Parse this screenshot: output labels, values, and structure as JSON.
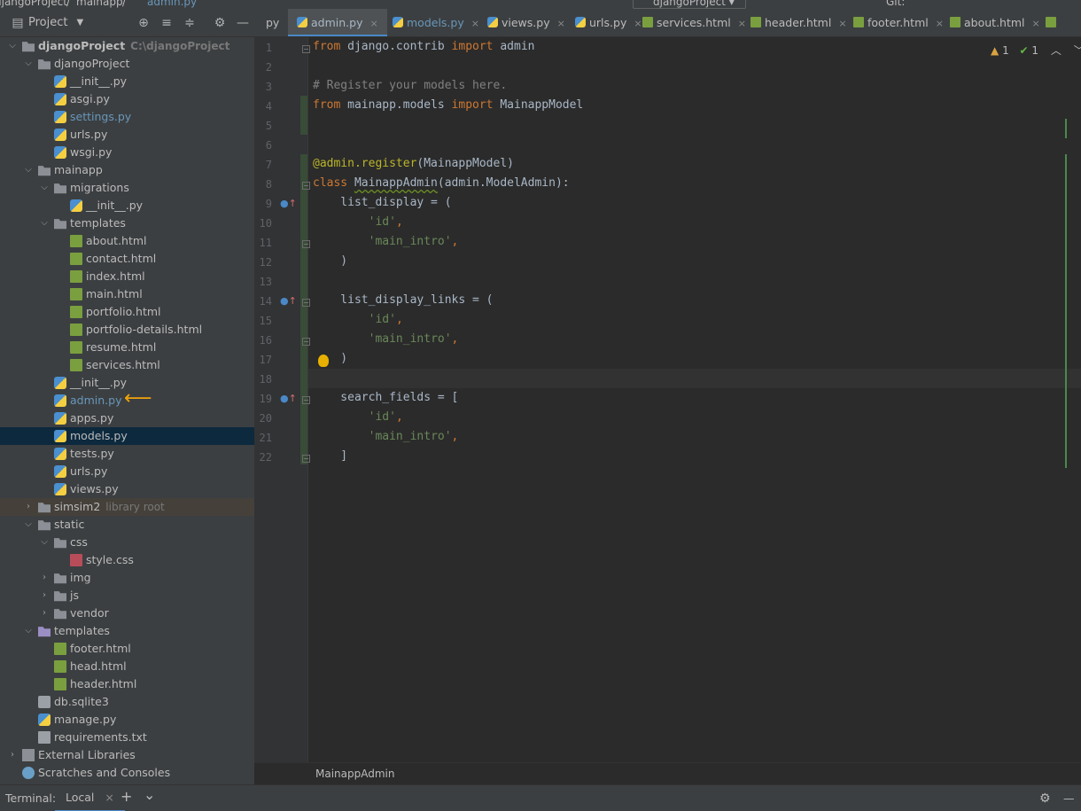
{
  "breadcrumb": {
    "project": "djangoProject",
    "sep": "/",
    "folder": "mainapp",
    "file": "admin.py"
  },
  "run_config": "djangoProject",
  "vcs_label": "Git:",
  "project_panel": {
    "title": "Project"
  },
  "tree": [
    {
      "label": "djangoProject",
      "hint": "C:\\djangoProject",
      "depth": 0,
      "arrow": "down",
      "icon": "folder-icon",
      "bold": true
    },
    {
      "label": "djangoProject",
      "depth": 1,
      "arrow": "down",
      "icon": "folder-icon"
    },
    {
      "label": "__init__.py",
      "depth": 2,
      "icon": "python-file-icon"
    },
    {
      "label": "asgi.py",
      "depth": 2,
      "icon": "python-file-icon"
    },
    {
      "label": "settings.py",
      "depth": 2,
      "icon": "python-file-icon",
      "color": "#6897bb"
    },
    {
      "label": "urls.py",
      "depth": 2,
      "icon": "python-file-icon"
    },
    {
      "label": "wsgi.py",
      "depth": 2,
      "icon": "python-file-icon"
    },
    {
      "label": "mainapp",
      "depth": 1,
      "arrow": "down",
      "icon": "folder-icon"
    },
    {
      "label": "migrations",
      "depth": 2,
      "arrow": "down",
      "icon": "folder-icon"
    },
    {
      "label": "__init__.py",
      "depth": 3,
      "icon": "python-file-icon"
    },
    {
      "label": "templates",
      "depth": 2,
      "arrow": "down",
      "icon": "folder-icon"
    },
    {
      "label": "about.html",
      "depth": 3,
      "icon": "html-file-icon"
    },
    {
      "label": "contact.html",
      "depth": 3,
      "icon": "html-file-icon"
    },
    {
      "label": "index.html",
      "depth": 3,
      "icon": "html-file-icon"
    },
    {
      "label": "main.html",
      "depth": 3,
      "icon": "html-file-icon"
    },
    {
      "label": "portfolio.html",
      "depth": 3,
      "icon": "html-file-icon"
    },
    {
      "label": "portfolio-details.html",
      "depth": 3,
      "icon": "html-file-icon"
    },
    {
      "label": "resume.html",
      "depth": 3,
      "icon": "html-file-icon"
    },
    {
      "label": "services.html",
      "depth": 3,
      "icon": "html-file-icon"
    },
    {
      "label": "__init__.py",
      "depth": 2,
      "icon": "python-file-icon"
    },
    {
      "label": "admin.py",
      "depth": 2,
      "icon": "python-file-icon",
      "color": "#6897bb"
    },
    {
      "label": "apps.py",
      "depth": 2,
      "icon": "python-file-icon"
    },
    {
      "label": "models.py",
      "depth": 2,
      "icon": "python-file-icon",
      "selected": true
    },
    {
      "label": "tests.py",
      "depth": 2,
      "icon": "python-file-icon"
    },
    {
      "label": "urls.py",
      "depth": 2,
      "icon": "python-file-icon"
    },
    {
      "label": "views.py",
      "depth": 2,
      "icon": "python-file-icon"
    },
    {
      "label": "simsim2",
      "hint": "library root",
      "depth": 1,
      "arrow": "right",
      "icon": "folder-icon",
      "lib": true
    },
    {
      "label": "static",
      "depth": 1,
      "arrow": "down",
      "icon": "folder-icon"
    },
    {
      "label": "css",
      "depth": 2,
      "arrow": "down",
      "icon": "folder-icon"
    },
    {
      "label": "style.css",
      "depth": 3,
      "icon": "css-file-icon"
    },
    {
      "label": "img",
      "depth": 2,
      "arrow": "right",
      "icon": "folder-icon"
    },
    {
      "label": "js",
      "depth": 2,
      "arrow": "right",
      "icon": "folder-icon"
    },
    {
      "label": "vendor",
      "depth": 2,
      "arrow": "right",
      "icon": "folder-icon"
    },
    {
      "label": "templates",
      "depth": 1,
      "arrow": "down",
      "icon": "templates-folder-icon"
    },
    {
      "label": "footer.html",
      "depth": 2,
      "icon": "html-file-icon"
    },
    {
      "label": "head.html",
      "depth": 2,
      "icon": "html-file-icon"
    },
    {
      "label": "header.html",
      "depth": 2,
      "icon": "html-file-icon"
    },
    {
      "label": "db.sqlite3",
      "depth": 1,
      "icon": "database-icon"
    },
    {
      "label": "manage.py",
      "depth": 1,
      "icon": "python-file-icon"
    },
    {
      "label": "requirements.txt",
      "depth": 1,
      "icon": "text-file-icon"
    },
    {
      "label": "External Libraries",
      "depth": 0,
      "arrow": "right",
      "icon": "library-icon"
    },
    {
      "label": "Scratches and Consoles",
      "depth": 0,
      "icon": "scratch-icon"
    }
  ],
  "tabs": [
    {
      "label": "py",
      "icon": "",
      "active": false
    },
    {
      "label": "admin.py",
      "icon": "python-file-icon",
      "active": true
    },
    {
      "label": "models.py",
      "icon": "python-file-icon",
      "active": false,
      "color": "#6897bb"
    },
    {
      "label": "views.py",
      "icon": "python-file-icon",
      "active": false
    },
    {
      "label": "urls.py",
      "icon": "python-file-icon",
      "active": false
    },
    {
      "label": "services.html",
      "icon": "html-file-icon",
      "active": false
    },
    {
      "label": "header.html",
      "icon": "html-file-icon",
      "active": false
    },
    {
      "label": "footer.html",
      "icon": "html-file-icon",
      "active": false
    },
    {
      "label": "about.html",
      "icon": "html-file-icon",
      "active": false
    },
    {
      "label": "",
      "icon": "html-file-icon",
      "active": false
    }
  ],
  "inspection": {
    "warnings": "1",
    "ok": "1"
  },
  "code_lines": [
    [
      {
        "t": "kw",
        "v": "from"
      },
      {
        "t": "",
        "v": " django.contrib "
      },
      {
        "t": "kw",
        "v": "import"
      },
      {
        "t": "",
        "v": " admin"
      }
    ],
    [],
    [
      {
        "t": "cm",
        "v": "# Register your models here."
      }
    ],
    [
      {
        "t": "kw",
        "v": "from"
      },
      {
        "t": "",
        "v": " mainapp.models "
      },
      {
        "t": "kw",
        "v": "import"
      },
      {
        "t": "",
        "v": " MainappModel"
      }
    ],
    [],
    [],
    [
      {
        "t": "dec",
        "v": "@admin.register"
      },
      {
        "t": "",
        "v": "(MainappModel)"
      }
    ],
    [
      {
        "t": "kw",
        "v": "class"
      },
      {
        "t": "",
        "v": " "
      },
      {
        "t": "cls",
        "v": "MainappAdmin"
      },
      {
        "t": "",
        "v": "(admin.ModelAdmin):"
      }
    ],
    [
      {
        "t": "",
        "v": "    list_display = ("
      }
    ],
    [
      {
        "t": "",
        "v": "        "
      },
      {
        "t": "st",
        "v": "'id'"
      },
      {
        "t": "kw",
        "v": ","
      }
    ],
    [
      {
        "t": "",
        "v": "        "
      },
      {
        "t": "st",
        "v": "'main_intro'"
      },
      {
        "t": "kw",
        "v": ","
      }
    ],
    [
      {
        "t": "",
        "v": "    )"
      }
    ],
    [],
    [
      {
        "t": "",
        "v": "    list_display_links = ("
      }
    ],
    [
      {
        "t": "",
        "v": "        "
      },
      {
        "t": "st",
        "v": "'id'"
      },
      {
        "t": "kw",
        "v": ","
      }
    ],
    [
      {
        "t": "",
        "v": "        "
      },
      {
        "t": "st",
        "v": "'main_intro'"
      },
      {
        "t": "kw",
        "v": ","
      }
    ],
    [
      {
        "t": "",
        "v": "    )"
      }
    ],
    [],
    [
      {
        "t": "",
        "v": "    search_fields = ["
      }
    ],
    [
      {
        "t": "",
        "v": "        "
      },
      {
        "t": "st",
        "v": "'id'"
      },
      {
        "t": "kw",
        "v": ","
      }
    ],
    [
      {
        "t": "",
        "v": "        "
      },
      {
        "t": "st",
        "v": "'main_intro'"
      },
      {
        "t": "kw",
        "v": ","
      }
    ],
    [
      {
        "t": "",
        "v": "    ]"
      }
    ]
  ],
  "line_numbers": [
    "1",
    "2",
    "3",
    "4",
    "5",
    "6",
    "7",
    "8",
    "9",
    "10",
    "11",
    "12",
    "13",
    "14",
    "15",
    "16",
    "17",
    "18",
    "19",
    "20",
    "21",
    "22"
  ],
  "override_lines": [
    9,
    14,
    19
  ],
  "editor_breadcrumb": "MainappAdmin",
  "terminal": {
    "label": "Terminal:",
    "tab": "Local",
    "close": "×",
    "add": "+",
    "more": "⌄"
  },
  "colors": {
    "accent": "#4a88c7",
    "selection": "#0d293e",
    "pointer_arrow": "#f0a30a"
  }
}
